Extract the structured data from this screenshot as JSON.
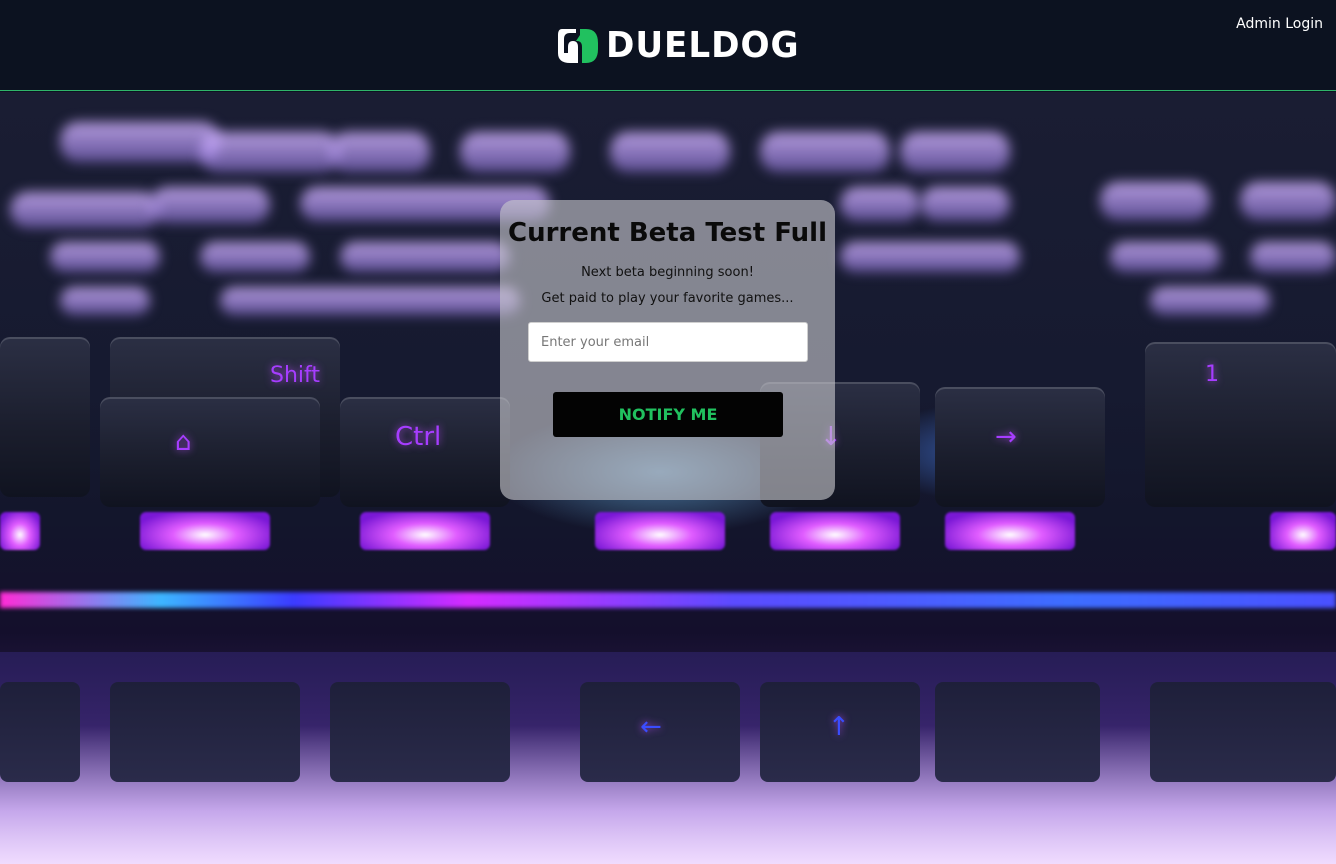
{
  "header": {
    "brand": "DUELDOG",
    "admin_login": "Admin Login",
    "border_color": "#2fb56a"
  },
  "hero": {
    "background": "keyboard-photo",
    "key_labels": [
      "Shift",
      "Ctrl",
      "⌂",
      "→",
      "↑",
      "↓",
      "←",
      "1"
    ]
  },
  "card": {
    "title": "Current Beta Test Full",
    "subtitle_1": "Next beta beginning soon!",
    "subtitle_2": "Get paid to play your favorite games...",
    "email_placeholder": "Enter your email",
    "email_value": "",
    "button_label": "NOTIFY ME",
    "button_text_color": "#21c15f"
  },
  "icons": {
    "logo": "dueldog-logo-icon"
  }
}
